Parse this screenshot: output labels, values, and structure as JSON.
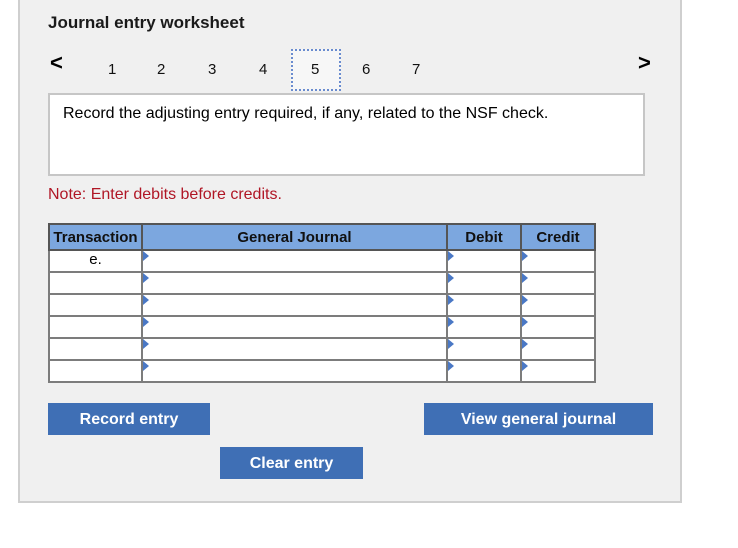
{
  "header": {
    "title": "Journal entry worksheet"
  },
  "pager": {
    "prev": "<",
    "next": ">",
    "pages": [
      "1",
      "2",
      "3",
      "4",
      "5",
      "6",
      "7"
    ],
    "active": "5"
  },
  "prompt": {
    "text": "Record the adjusting entry required, if any, related to the NSF check."
  },
  "note": "Note: Enter debits before credits.",
  "table": {
    "headers": {
      "transaction": "Transaction",
      "general_journal": "General Journal",
      "debit": "Debit",
      "credit": "Credit"
    },
    "rows": [
      {
        "transaction": "e.",
        "account": "",
        "debit": "",
        "credit": ""
      },
      {
        "transaction": "",
        "account": "",
        "debit": "",
        "credit": ""
      },
      {
        "transaction": "",
        "account": "",
        "debit": "",
        "credit": ""
      },
      {
        "transaction": "",
        "account": "",
        "debit": "",
        "credit": ""
      },
      {
        "transaction": "",
        "account": "",
        "debit": "",
        "credit": ""
      },
      {
        "transaction": "",
        "account": "",
        "debit": "",
        "credit": ""
      }
    ]
  },
  "buttons": {
    "record": "Record entry",
    "clear": "Clear entry",
    "view": "View general journal"
  },
  "colors": {
    "button": "#3f6fb5",
    "header": "#7ca7df",
    "note": "#b01625"
  }
}
